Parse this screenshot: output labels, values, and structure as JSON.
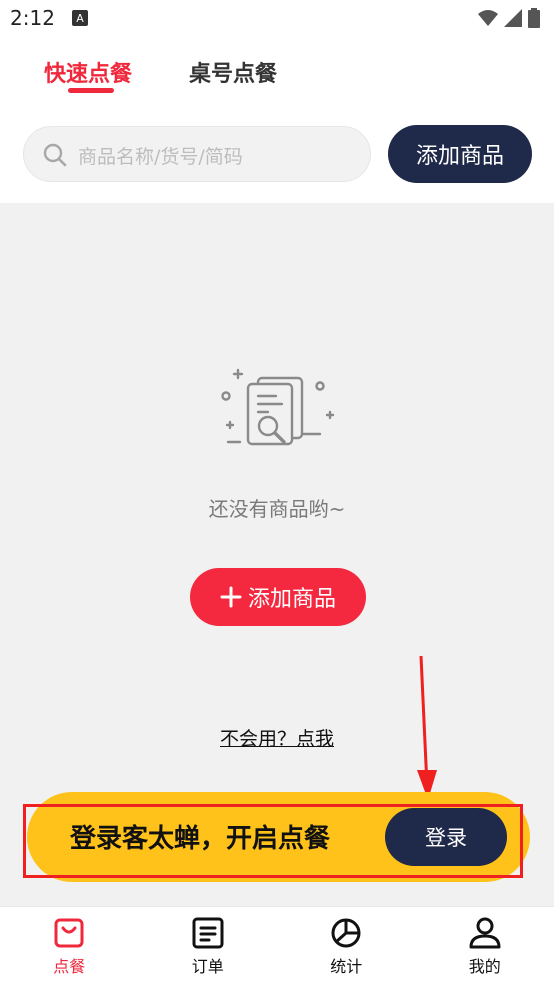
{
  "status_bar": {
    "time": "2:12"
  },
  "tabs": [
    {
      "label": "快速点餐"
    },
    {
      "label": "桌号点餐"
    }
  ],
  "search": {
    "placeholder": "商品名称/货号/简码"
  },
  "top_add_button": "添加商品",
  "empty_state": {
    "message": "还没有商品哟~",
    "add_button": "添加商品",
    "help_link": "不会用？点我"
  },
  "login_banner": {
    "text": "登录客太蝉，开启点餐",
    "button": "登录"
  },
  "bottom_nav": [
    {
      "label": "点餐",
      "icon": "bag-icon"
    },
    {
      "label": "订单",
      "icon": "order-icon"
    },
    {
      "label": "统计",
      "icon": "pie-chart-icon"
    },
    {
      "label": "我的",
      "icon": "user-icon"
    }
  ],
  "colors": {
    "accent": "#f0283c",
    "navy": "#1f2a4a",
    "banner": "#ffc21a"
  }
}
